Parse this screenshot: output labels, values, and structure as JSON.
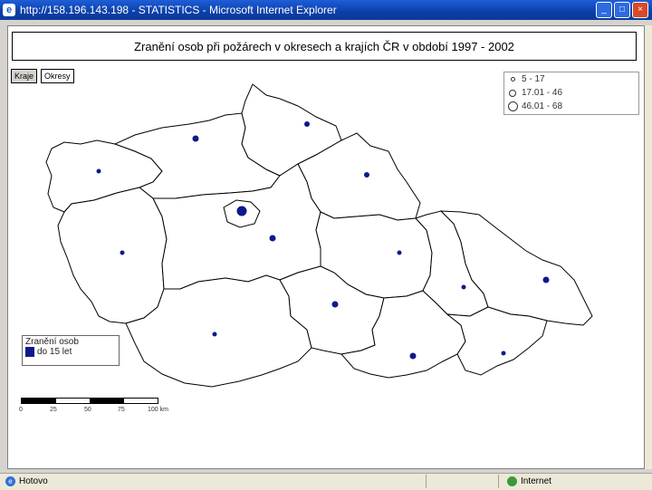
{
  "window": {
    "title": "http://158.196.143.198 - STATISTICS - Microsoft Internet Explorer",
    "app_icon": "ie-icon",
    "buttons": {
      "minimize": "_",
      "maximize": "□",
      "close": "×"
    }
  },
  "page": {
    "heading": "Zranění osob při požárech v okresech a krajích ČR v období 1997 - 2002",
    "tabs": [
      {
        "label": "Kraje",
        "active": true
      },
      {
        "label": "Okresy",
        "active": false
      }
    ],
    "size_legend": [
      {
        "label": "5 - 17"
      },
      {
        "label": "17.01 - 46"
      },
      {
        "label": "46.01 - 68"
      }
    ],
    "key": {
      "title": "Zranění osob",
      "item": "do 15 let",
      "color": "#0e1a8a"
    },
    "scale": {
      "ticks": [
        "0",
        "25",
        "50",
        "75",
        "100 km"
      ]
    }
  },
  "statusbar": {
    "left": "Hotovo",
    "right": "Internet"
  },
  "colors": {
    "dot": "#0e1a8a",
    "titlebar": "#0a3fa8"
  }
}
